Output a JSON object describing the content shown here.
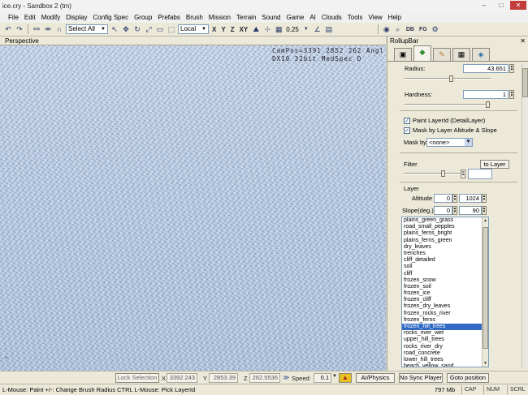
{
  "window": {
    "title": "ice.cry - Sandbox 2 (tm)",
    "min": "–",
    "max": "□",
    "close": "✕"
  },
  "menu": [
    "File",
    "Edit",
    "Modify",
    "Display",
    "Config Spec",
    "Group",
    "Prefabs",
    "Brush",
    "Mission",
    "Terrain",
    "Sound",
    "Game",
    "AI",
    "Clouds",
    "Tools",
    "View",
    "Help"
  ],
  "toolbar": {
    "selection_mode": "Select All",
    "coord_system": "Local",
    "axes": [
      "X",
      "Y",
      "Z",
      "XY"
    ],
    "grid_value": "0.25",
    "right_labels": [
      "DB",
      "FG"
    ]
  },
  "viewport": {
    "label": "Perspective",
    "stats_line1": "CamPos=3391 2852 262 Angl",
    "stats_line2": "DX10 32bit MedSpec D"
  },
  "rollup": {
    "title": "RollupBar",
    "close": "✕",
    "tabs": [
      {
        "name": "objects",
        "icon": "▣"
      },
      {
        "name": "terrain",
        "icon": "◆"
      },
      {
        "name": "modeling",
        "icon": "✎"
      },
      {
        "name": "display",
        "icon": "▦"
      },
      {
        "name": "layers",
        "icon": "◈"
      }
    ],
    "radius_label": "Radius:",
    "radius_value": "43.651",
    "radius_fraction": 0.55,
    "hardness_label": "Hardness:",
    "hardness_value": "1",
    "hardness_fraction": 1.0,
    "paint_layer_label": "Paint LayerId (DetailLayer)",
    "mask_altitude_label": "Mask by Layer Altitude & Slope",
    "mask_by_label": "Mask by",
    "mask_by_value": "<none>",
    "filter_label": "Filter",
    "to_layer_button": "to Layer",
    "filter_fraction": 0.72,
    "filter_small": "1",
    "layer_label": "Layer",
    "altitude_label": "Altitude",
    "altitude_min": "0",
    "altitude_max": "1024",
    "slope_label": "Slope(deg.)",
    "slope_min": "0",
    "slope_max": "90",
    "layers": [
      "plains_green_grass",
      "road_small_pepples",
      "plains_ferns_bright",
      "plains_ferns_green",
      "dry_leaves",
      "trenches",
      "cliff_detailed",
      "soil",
      "cliff",
      "frozen_snow",
      "frozen_soil",
      "frozen_ice",
      "frozen_cliff",
      "frozen_dry_leaves",
      "frozen_rocks_river",
      "frozen_ferns",
      "frozen_hill_trees",
      "rocks_river_wet",
      "upper_hill_trees",
      "rocks_river_dry",
      "road_concrete",
      "lower_hill_trees",
      "beach_yellow_sand"
    ],
    "selected_layer": "frozen_hill_trees"
  },
  "statusbar": {
    "lock_selection": "Lock Selection",
    "x_label": "X",
    "x_value": "3392.243",
    "y_label": "Y",
    "y_value": "2853.39",
    "z_label": "Z",
    "z_value": "262.5536",
    "speed_label": "Speed:",
    "speed_value": "0.1",
    "ai_physics": "AI/Physics",
    "no_sync": "No Sync Player",
    "goto": "Goto position"
  },
  "hintbar": {
    "hint": "L-Mouse: Paint   +/-: Change Brush Radius   CTRL L-Mouse: Pick LayerId",
    "memory": "797 Mb",
    "caps": "CAP",
    "num": "NUM",
    "scrl": "SCRL"
  }
}
